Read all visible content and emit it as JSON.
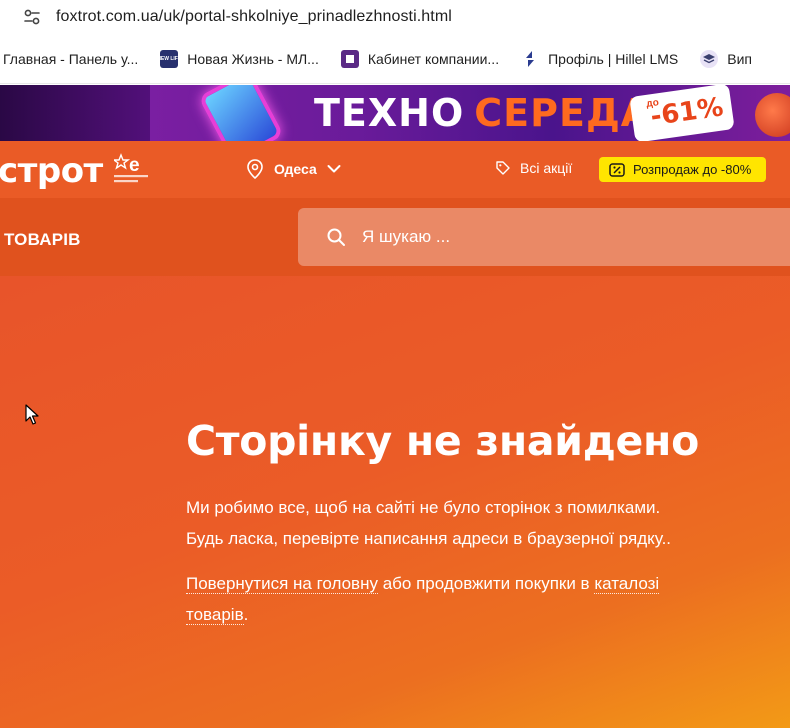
{
  "browser": {
    "url": "foxtrot.com.ua/uk/portal-shkolniye_prinadlezhnosti.html",
    "bookmarks": [
      {
        "label": "Главная - Панель у...",
        "icon": "blank"
      },
      {
        "label": "Новая Жизнь - МЛ...",
        "icon": "new-life-icon",
        "icon_text": "NEW LIFE"
      },
      {
        "label": "Кабинет компании...",
        "icon": "square-icon"
      },
      {
        "label": "Профіль | Hillel LMS",
        "icon": "hillel-icon"
      },
      {
        "label": "Вип",
        "icon": "stack-icon"
      }
    ]
  },
  "banner": {
    "word1": "ТЕХНО",
    "word2": "СЕРЕДА",
    "badge_prefix": "до",
    "badge_value": "-61%"
  },
  "header": {
    "logo": "строт",
    "city": "Одеса",
    "promos": "Всі акції",
    "sale": "Розпродаж до -80%"
  },
  "nav": {
    "catalog": "ТОВАРІВ",
    "search_placeholder": "Я шукаю ..."
  },
  "error": {
    "title": "Сторінку не знайдено",
    "line1": "Ми робимо все, щоб на сайті не було сторінок з помилками.",
    "line2": "Будь ласка, перевірте написання адреси в браузерної рядку..",
    "link_home": "Повернутися на головну",
    "middle": " або продовжити покупки в ",
    "link_catalog_1": "каталозі",
    "link_catalog_2": "товарів",
    "end": "."
  },
  "colors": {
    "brand_orange": "#ea5b26",
    "sale_yellow": "#ffe500"
  }
}
